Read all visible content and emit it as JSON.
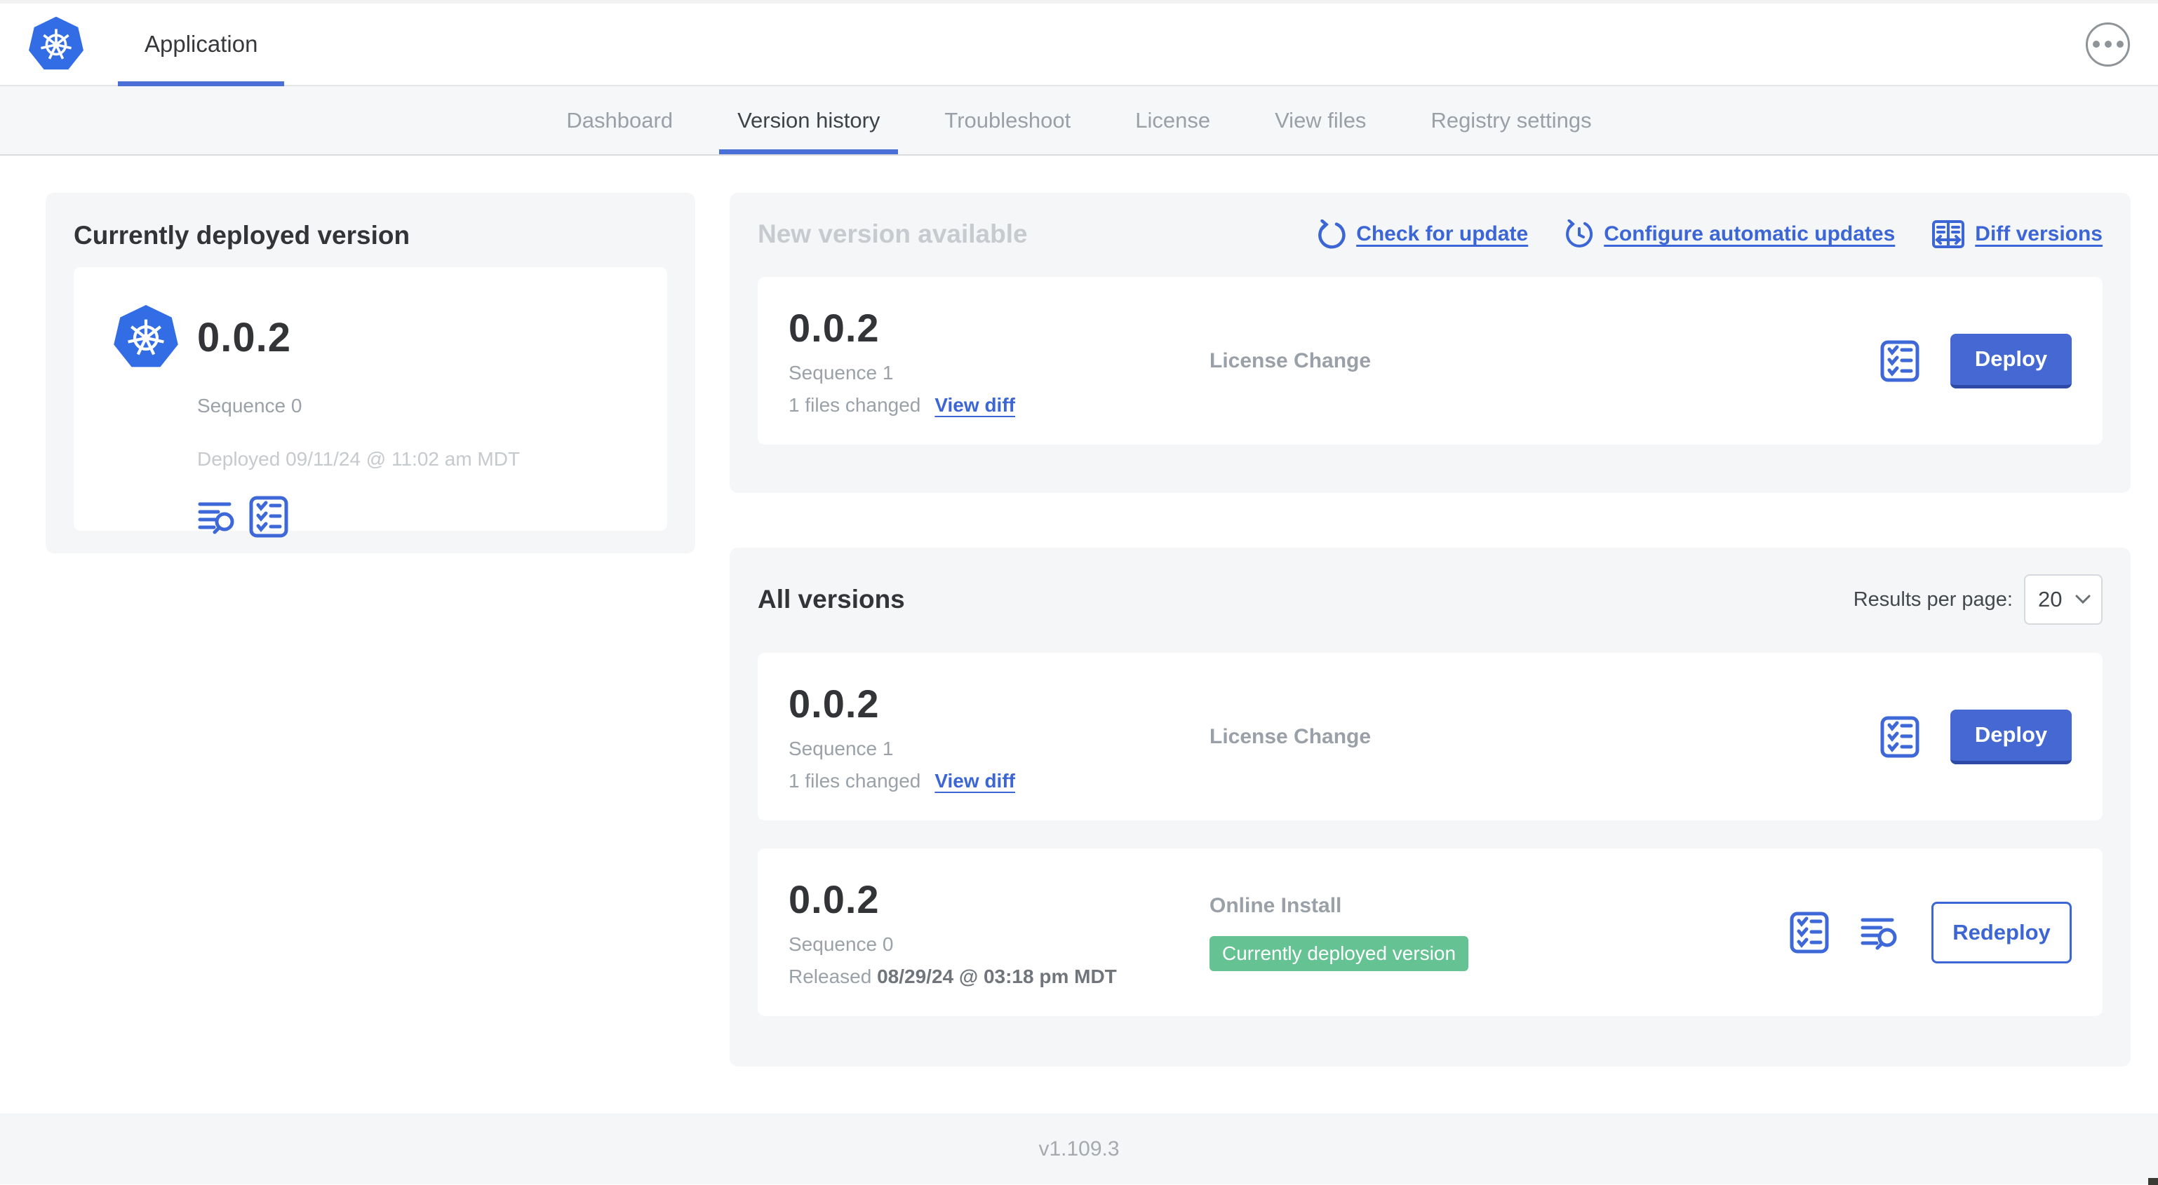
{
  "header": {
    "app_title": "Application"
  },
  "nav": {
    "tabs": [
      {
        "label": "Dashboard"
      },
      {
        "label": "Version history"
      },
      {
        "label": "Troubleshoot"
      },
      {
        "label": "License"
      },
      {
        "label": "View files"
      },
      {
        "label": "Registry settings"
      }
    ]
  },
  "current_version_card": {
    "title": "Currently deployed version",
    "version": "0.0.2",
    "sequence": "Sequence 0",
    "deployed": "Deployed 09/11/24 @ 11:02 am MDT"
  },
  "new_version_card": {
    "title": "New version available",
    "links": {
      "check_for_update": "Check for update",
      "configure_automatic_updates": "Configure automatic updates",
      "diff_versions": "Diff versions"
    },
    "row": {
      "version": "0.0.2",
      "sequence": "Sequence 1",
      "files_changed": "1 files changed",
      "view_diff": "View diff",
      "source": "License Change",
      "action": "Deploy"
    }
  },
  "all_versions_card": {
    "title": "All versions",
    "results_per_page_label": "Results per page:",
    "results_per_page_value": "20",
    "rows": [
      {
        "version": "0.0.2",
        "sequence": "Sequence 1",
        "files_changed": "1 files changed",
        "view_diff": "View diff",
        "source": "License Change",
        "action": "Deploy"
      },
      {
        "version": "0.0.2",
        "sequence": "Sequence 0",
        "released_prefix": "Released ",
        "released_date": "08/29/24 @ 03:18 pm MDT",
        "source": "Online Install",
        "badge": "Currently deployed version",
        "action": "Redeploy"
      }
    ]
  },
  "footer": {
    "version": "v1.109.3"
  },
  "colors": {
    "accent_blue": "#3c66d6",
    "button_blue": "#4568d2",
    "badge_green": "#65c393",
    "k8s_blue": "#326de6",
    "card_gray": "#f4f6f8"
  }
}
